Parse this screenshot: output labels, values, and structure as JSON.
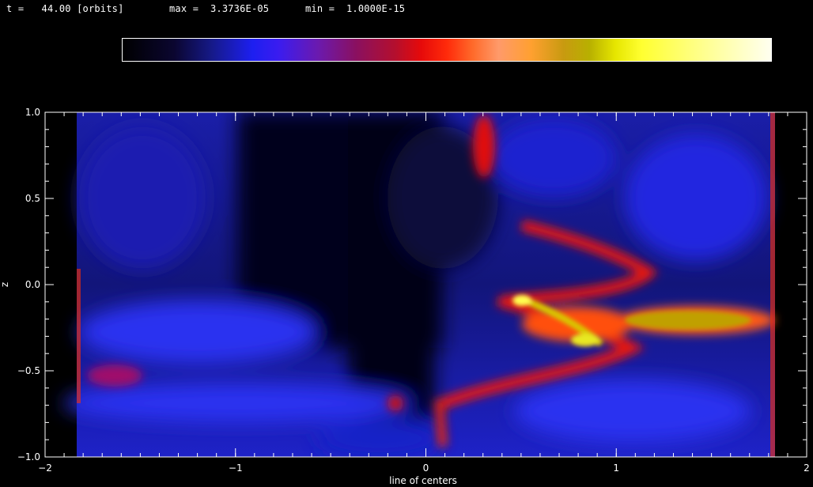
{
  "header": {
    "time_text": "t =   44.00 [orbits]",
    "max_text": "max =  3.3736E-05",
    "min_text": "min =  1.0000E-15"
  },
  "colorbar": {
    "colors": [
      "#000000",
      "#1d1ff0",
      "#8a1060",
      "#e60a0a",
      "#ff9a6a",
      "#b8b000",
      "#ffff30",
      "#fffff0"
    ]
  },
  "chart_data": {
    "type": "heatmap",
    "xlabel": "line of centers",
    "ylabel": "z",
    "xlim": [
      -2,
      2
    ],
    "ylim": [
      -1,
      1
    ],
    "x_ticks": [
      -2,
      -1,
      0,
      1,
      2
    ],
    "x_tick_labels": [
      "−2",
      "−1",
      "0",
      "1",
      "2"
    ],
    "y_ticks": [
      -1.0,
      -0.5,
      0.0,
      0.5,
      1.0
    ],
    "y_tick_labels": [
      "−1.0",
      "−0.5",
      "0.0",
      "0.5",
      "1.0"
    ],
    "x_minor_step": 0.1,
    "y_minor_step": 0.1
  }
}
